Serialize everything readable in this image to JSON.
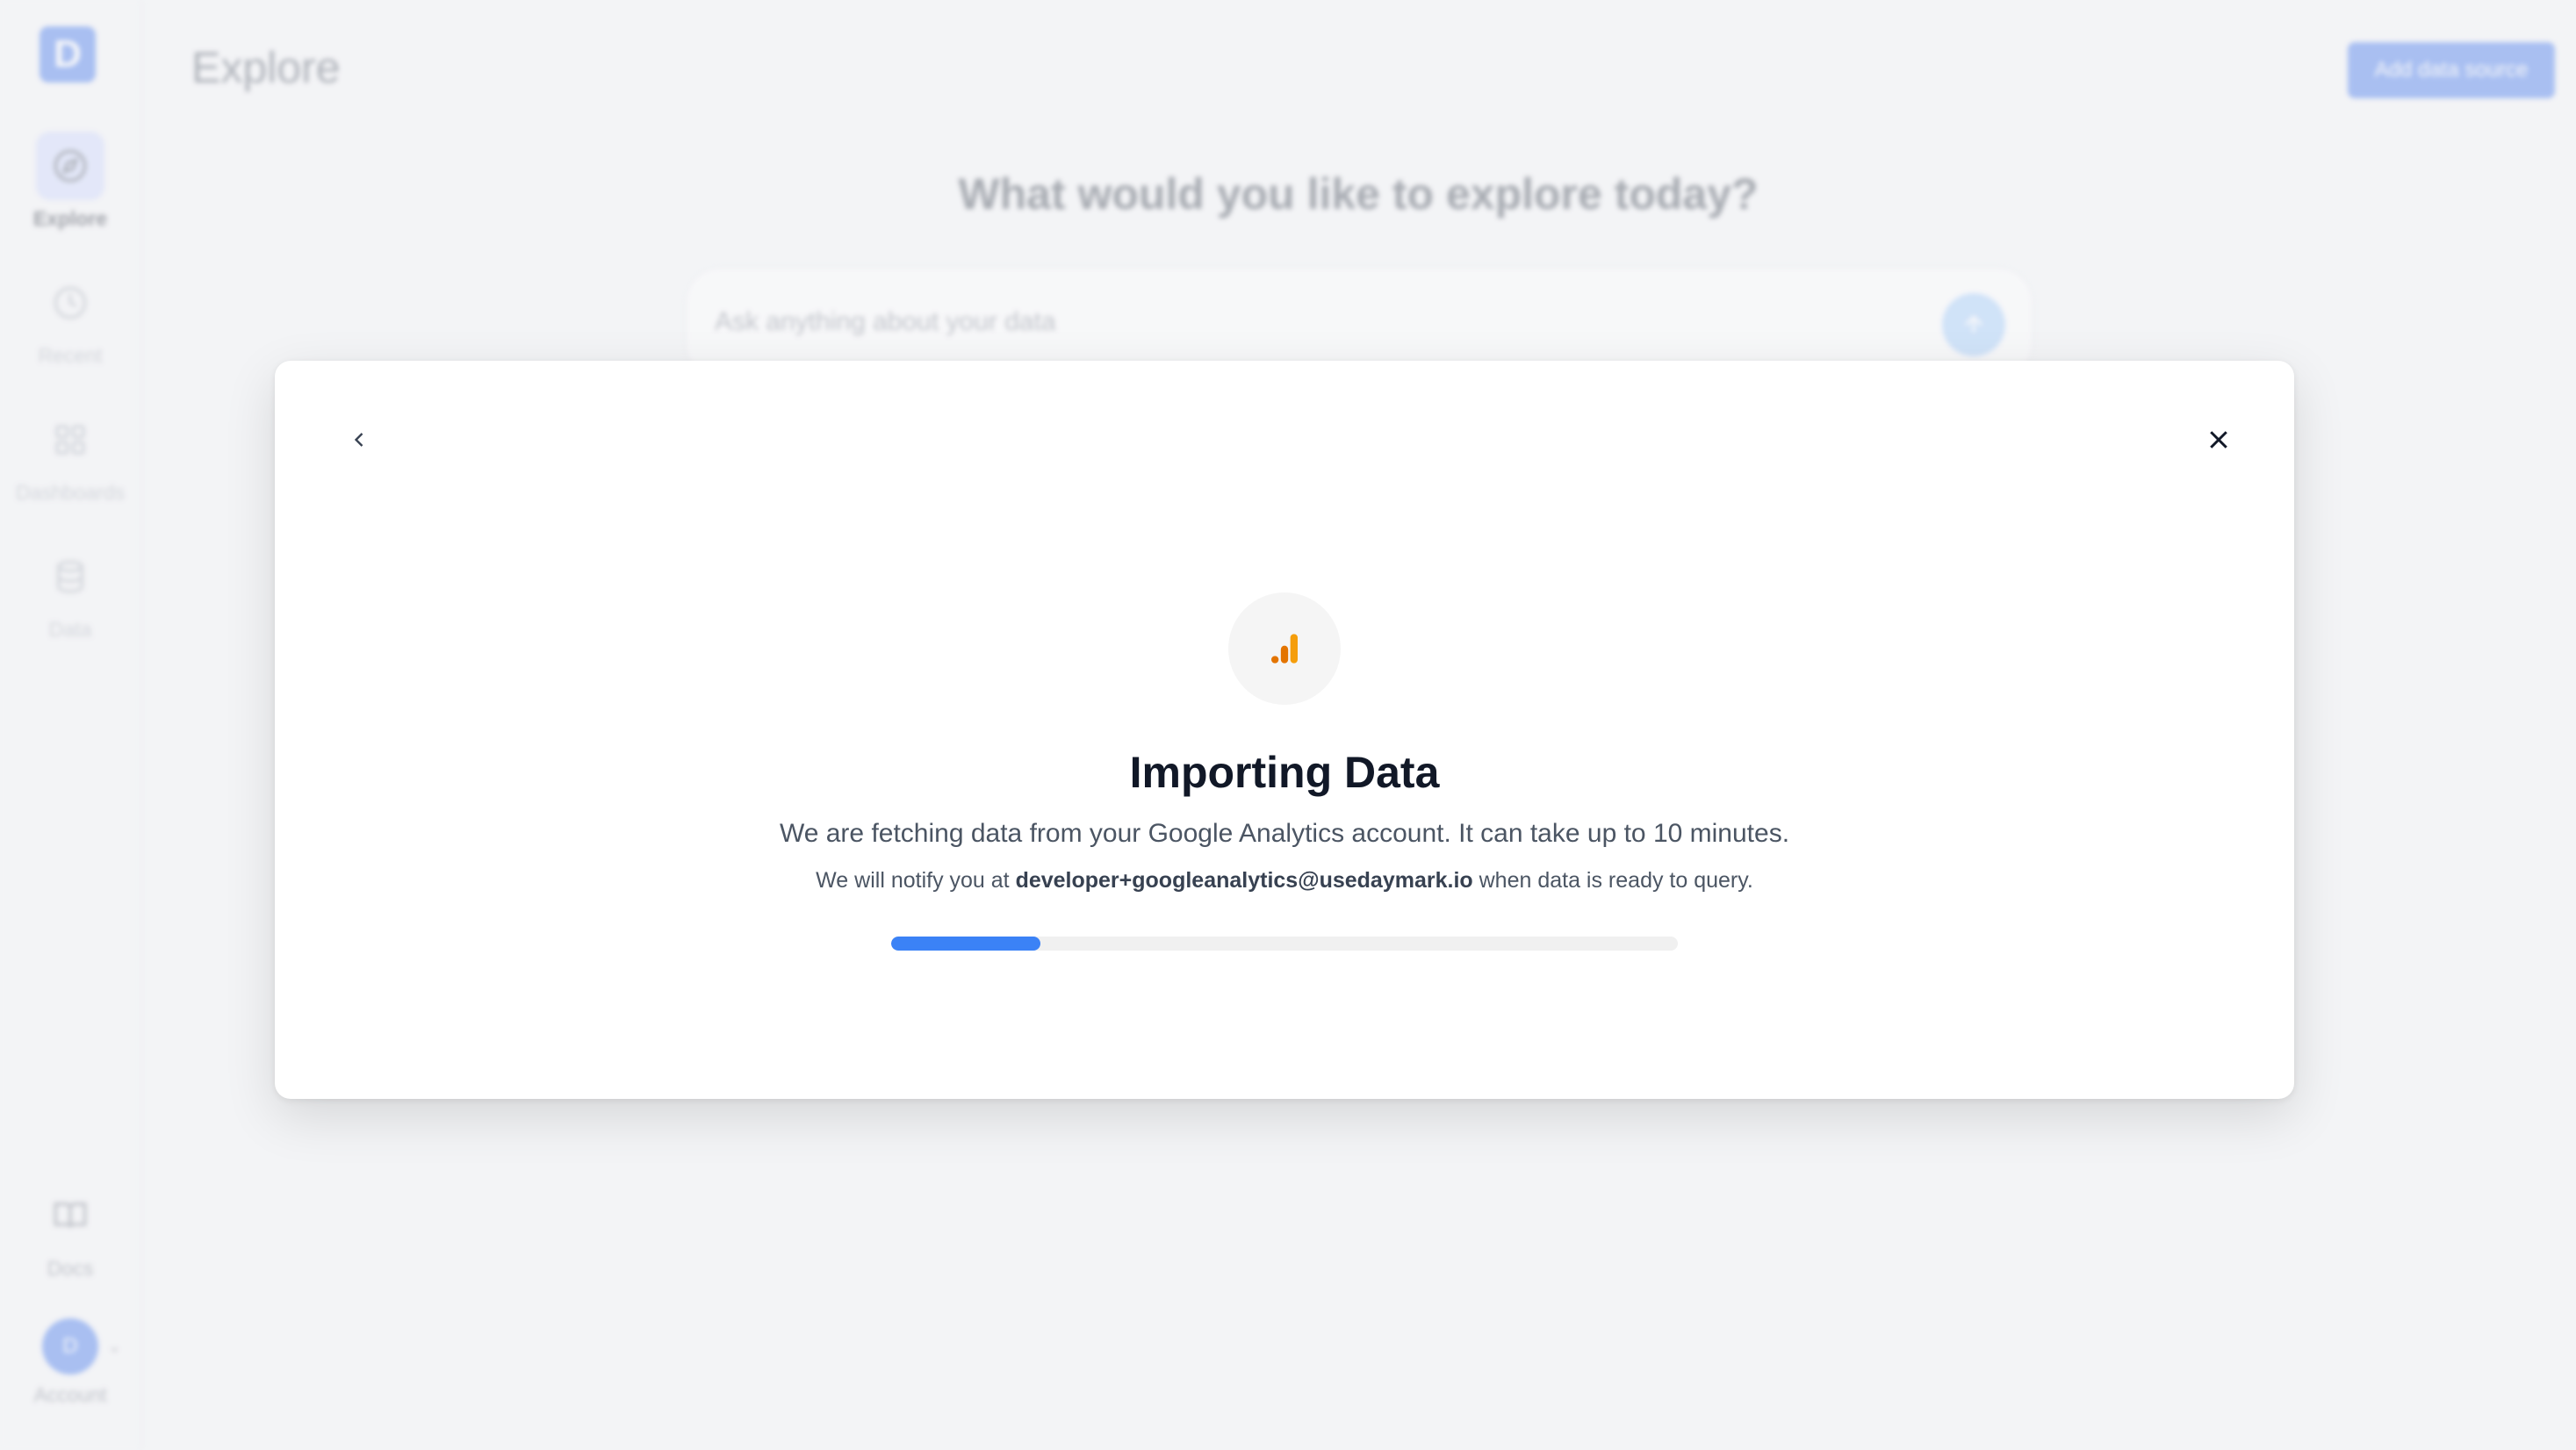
{
  "app": {
    "logo_letter": "D",
    "page_title": "Explore",
    "add_source_label": "Add data source",
    "hero": "What would you like to explore today?",
    "ask_placeholder": "Ask anything about your data"
  },
  "sidebar": {
    "items": [
      {
        "label": "Explore",
        "icon": "compass-icon",
        "active": true
      },
      {
        "label": "Recent",
        "icon": "clock-icon"
      },
      {
        "label": "Dashboards",
        "icon": "grid-icon"
      },
      {
        "label": "Data",
        "icon": "database-icon"
      }
    ],
    "docs_label": "Docs",
    "account_label": "Account",
    "avatar_initial": "D"
  },
  "modal": {
    "title": "Importing Data",
    "description": "We are fetching data from your Google Analytics account. It can take up to 10 minutes.",
    "note_prefix": "We will notify you at ",
    "email": "developer+googleanalytics@usedaymark.io",
    "note_suffix": " when data is ready to query.",
    "source_icon": "google-analytics-icon",
    "progress": 0.19
  },
  "colors": {
    "accent": "#3b82f6",
    "ga_orange": "#f59e0b",
    "ga_dark_orange": "#e37400"
  }
}
